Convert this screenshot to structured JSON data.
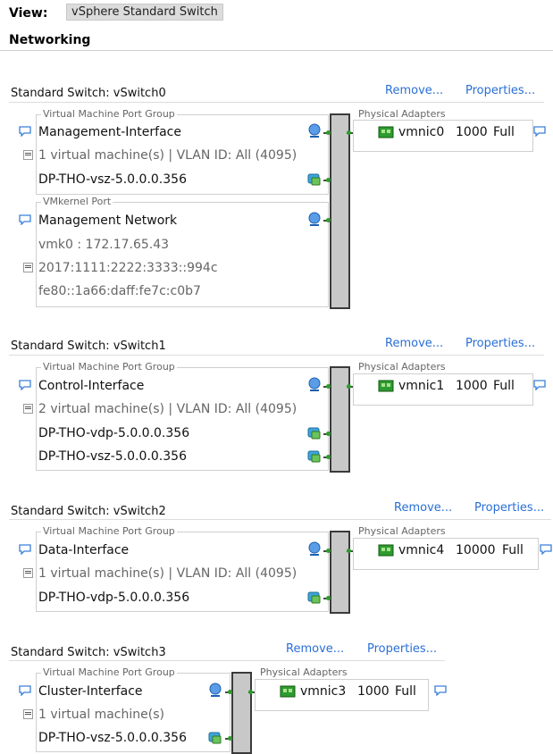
{
  "view": {
    "label": "View:",
    "value": "vSphere Standard Switch"
  },
  "section_title": "Networking",
  "switches": [
    {
      "title": "Standard Switch: vSwitch0",
      "remove": "Remove...",
      "properties": "Properties...",
      "vm_pg_legend": "Virtual Machine Port Group",
      "vm_pg_name": "Management-Interface",
      "vm_pg_info": "1 virtual machine(s) | VLAN ID: All (4095)",
      "vms": [
        "DP-THO-vsz-5.0.0.0.356"
      ],
      "vmk_legend": "VMkernel Port",
      "vmk_name": "Management Network",
      "vmk_addr": "vmk0 : 172.17.65.43",
      "vmk_ipv6_a": "2017:1111:2222:3333::994c",
      "vmk_ipv6_b": "fe80::1a66:daff:fe7c:c0b7",
      "pa_legend": "Physical Adapters",
      "pa_nic": "vmnic0",
      "pa_speed": "1000",
      "pa_duplex": "Full"
    },
    {
      "title": "Standard Switch: vSwitch1",
      "remove": "Remove...",
      "properties": "Properties...",
      "vm_pg_legend": "Virtual Machine Port Group",
      "vm_pg_name": "Control-Interface",
      "vm_pg_info": "2 virtual machine(s) | VLAN ID: All (4095)",
      "vms": [
        "DP-THO-vdp-5.0.0.0.356",
        "DP-THO-vsz-5.0.0.0.356"
      ],
      "pa_legend": "Physical Adapters",
      "pa_nic": "vmnic1",
      "pa_speed": "1000",
      "pa_duplex": "Full"
    },
    {
      "title": "Standard Switch: vSwitch2",
      "remove": "Remove...",
      "properties": "Properties...",
      "vm_pg_legend": "Virtual Machine Port Group",
      "vm_pg_name": "Data-Interface",
      "vm_pg_info": "1 virtual machine(s) | VLAN ID: All (4095)",
      "vms": [
        "DP-THO-vdp-5.0.0.0.356"
      ],
      "pa_legend": "Physical Adapters",
      "pa_nic": "vmnic4",
      "pa_speed": "10000",
      "pa_duplex": "Full"
    },
    {
      "title": "Standard Switch: vSwitch3",
      "remove": "Remove...",
      "properties": "Properties...",
      "vm_pg_legend": "Virtual Machine Port Group",
      "vm_pg_name": "Cluster-Interface",
      "vm_pg_info": "1 virtual machine(s)",
      "vms": [
        "DP-THO-vsz-5.0.0.0.356"
      ],
      "pa_legend": "Physical Adapters",
      "pa_nic": "vmnic3",
      "pa_speed": "1000",
      "pa_duplex": "Full"
    }
  ],
  "colors": {
    "link": "#2a6fd6",
    "nic_green": "#2e9b2e",
    "bar_fill": "#c8c8c8"
  }
}
